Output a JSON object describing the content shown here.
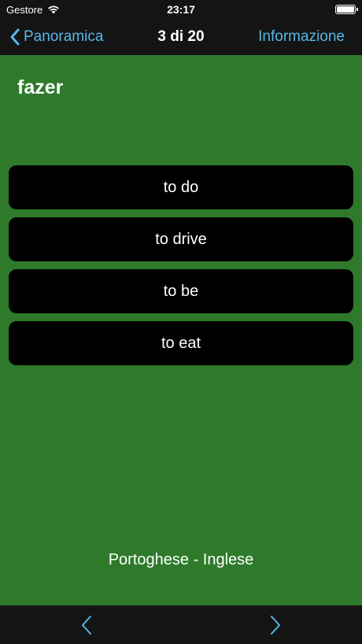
{
  "status_bar": {
    "carrier": "Gestore",
    "time": "23:17"
  },
  "nav": {
    "back_label": "Panoramica",
    "title": "3 di 20",
    "info_label": "Informazione"
  },
  "question": {
    "word": "fazer"
  },
  "answers": [
    "to do",
    "to drive",
    "to be",
    "to eat"
  ],
  "footer": {
    "language_pair": "Portoghese - Inglese"
  },
  "icons": {
    "back": "chevron-left-icon",
    "prev": "chevron-left-icon",
    "next": "chevron-right-icon",
    "wifi": "wifi-icon",
    "battery": "battery-icon"
  },
  "colors": {
    "background": "#2e7a2a",
    "bar": "#141414",
    "accent": "#58b7e8",
    "answer_bg": "#000000"
  }
}
